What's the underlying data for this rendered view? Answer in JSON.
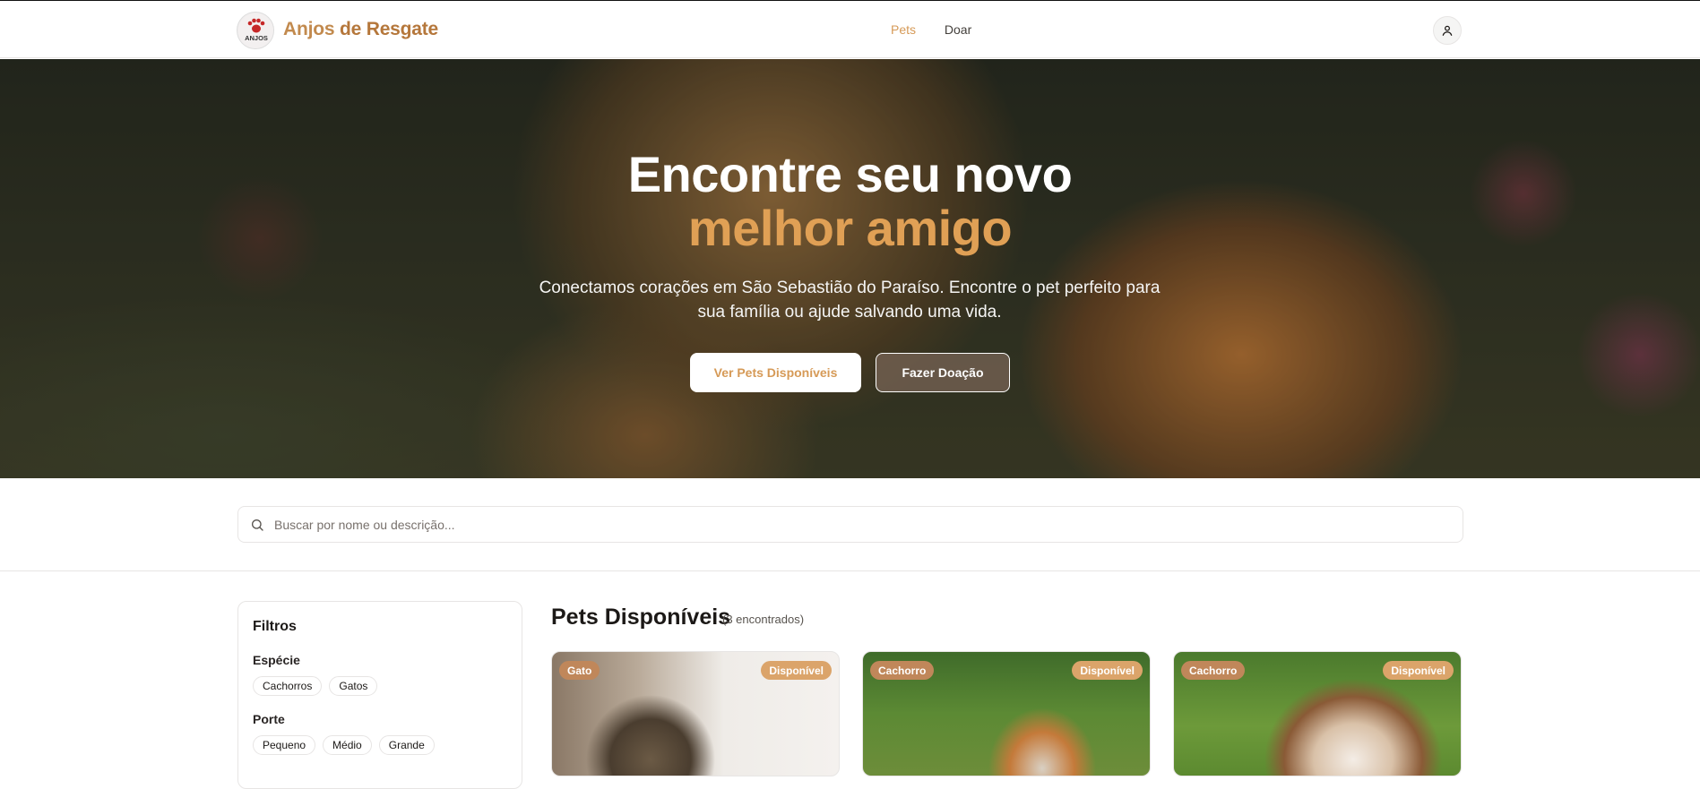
{
  "header": {
    "brand_part1": "Anjos",
    "brand_part2": "de Resgate",
    "logo_text": "ANJOS",
    "nav": [
      {
        "label": "Pets",
        "active": true
      },
      {
        "label": "Doar",
        "active": false
      }
    ],
    "user_icon": "user-icon"
  },
  "hero": {
    "title_line1": "Encontre seu novo",
    "title_line2": "melhor amigo",
    "subtitle": "Conectamos corações em São Sebastião do Paraíso. Encontre o pet perfeito para sua família ou ajude salvando uma vida.",
    "primary_button": "Ver Pets Disponíveis",
    "secondary_button": "Fazer Doação"
  },
  "search": {
    "placeholder": "Buscar por nome ou descrição...",
    "value": ""
  },
  "filters": {
    "title": "Filtros",
    "species_label": "Espécie",
    "species_options": [
      "Cachorros",
      "Gatos"
    ],
    "size_label": "Porte",
    "size_options": [
      "Pequeno",
      "Médio",
      "Grande"
    ]
  },
  "results": {
    "title": "Pets Disponíveis",
    "count_text": "(3 encontrados)",
    "pets": [
      {
        "species": "Gato",
        "status": "Disponível"
      },
      {
        "species": "Cachorro",
        "status": "Disponível"
      },
      {
        "species": "Cachorro",
        "status": "Disponível"
      }
    ]
  },
  "colors": {
    "accent": "#d69a57",
    "brand": "#c28a4e",
    "species_badge": "#c0875a",
    "status_badge": "#dba46a"
  }
}
